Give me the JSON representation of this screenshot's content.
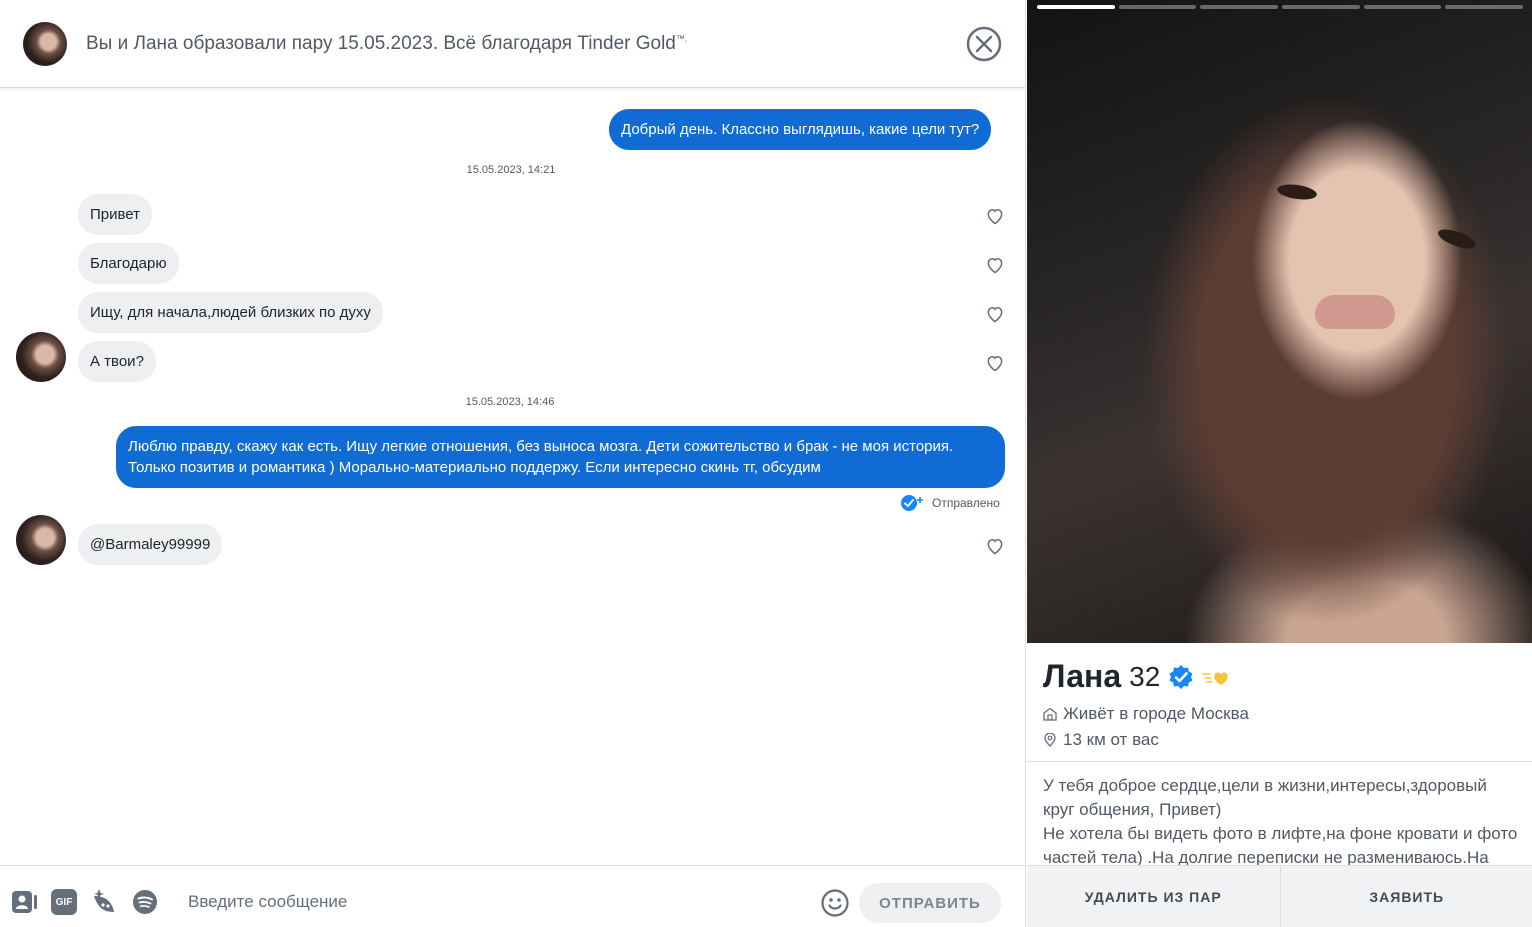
{
  "header": {
    "title": "Вы и Лана образовали пару 15.05.2023. Всё благодаря Tinder Gold",
    "trademark": "™."
  },
  "messages": {
    "m1": "Добрый день. Классно выглядишь, какие цели тут?",
    "ts1": "15.05.2023, 14:21",
    "m2": "Привет",
    "m3": "Благодарю",
    "m4": "Ищу, для начала,людей близких по духу",
    "m5": "А твои?",
    "ts2": "15.05.2023, 14:46",
    "m6": "Люблю правду, скажу как есть. Ищу легкие отношения, без выноса мозга. Дети сожительство и брак - не моя история. Только позитив и романтика ) Морально-материально поддержу. Если интересно скинь тг, обсудим",
    "sent_status": "Отправлено",
    "m7": "@Barmaley99999"
  },
  "composer": {
    "placeholder": "Введите сообщение",
    "gif_label": "GIF",
    "send_label": "ОТПРАВИТЬ"
  },
  "profile": {
    "name": "Лана",
    "age": "32",
    "lives": "Живёт в городе Москва",
    "distance": "13 км от вас",
    "bio": "У тебя доброе сердце,цели в жизни,интересы,здоровый круг общения, Привет)\nНе хотела бы видеть фото в лифте,на фоне кровати и фото частей тела) .На долгие переписки не размениваюсь.На все",
    "photo_count": 6,
    "photo_active_index": 0,
    "unmatch_label": "УДАЛИТЬ ИЗ ПАР",
    "report_label": "ЗАЯВИТЬ"
  },
  "colors": {
    "outgoing_bubble": "#106bd5",
    "incoming_bubble": "#eeeff1",
    "verified": "#1786f8",
    "gold": "#f5c33b"
  }
}
